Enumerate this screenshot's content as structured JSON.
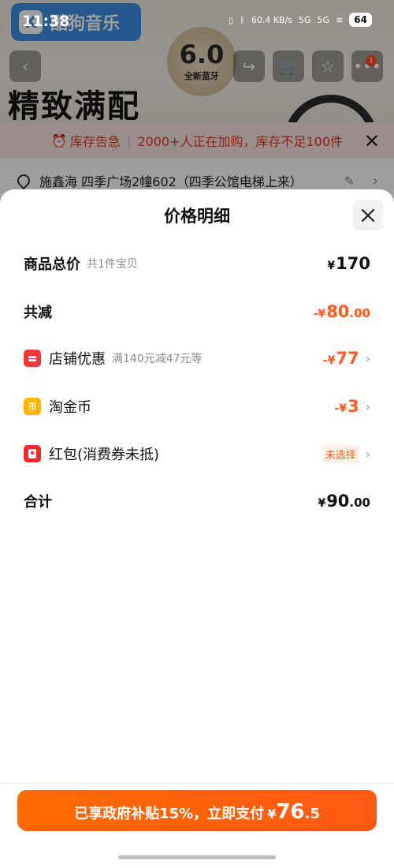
{
  "status_bar": {
    "time": "11:38",
    "net_speed": "60.4 KB/s",
    "signal_1": "5G",
    "signal_2": "5G",
    "battery": "64"
  },
  "background": {
    "brand": "酷狗音乐",
    "badge_number": "6.0",
    "badge_text": "全新蓝牙",
    "title": "精致满配",
    "cart_count": "1",
    "stock_alert": {
      "label": "库存告急",
      "message": "2000+人正在加购，库存不足100件"
    },
    "address": "施鑫海 四季广场2幢602（四季公馆电梯上来）"
  },
  "sheet": {
    "title": "价格明细",
    "rows": {
      "total": {
        "label": "商品总价",
        "sub": "共1件宝贝",
        "yen": "¥",
        "value": "170"
      },
      "discount": {
        "label": "共减",
        "prefix": "-¥",
        "int": "80",
        "dec": ".00"
      },
      "shop": {
        "label": "店铺优惠",
        "sub": "满140元减47元等",
        "prefix": "-¥",
        "value": "77"
      },
      "coin": {
        "label": "淘金币",
        "prefix": "-¥",
        "value": "3"
      },
      "redpacket": {
        "label": "红包(消费券未抵)",
        "status": "未选择"
      },
      "sum": {
        "label": "合计",
        "yen": "¥",
        "int": "90",
        "dec": ".00"
      }
    }
  },
  "pay_button": {
    "text": "已享政府补贴15%，立即支付",
    "yen": "¥",
    "int": "76",
    "dec": ".5"
  },
  "colors": {
    "accent": "#ff5a1f",
    "shop_icon": "#f03a3a",
    "coin_icon": "#ffb400"
  }
}
